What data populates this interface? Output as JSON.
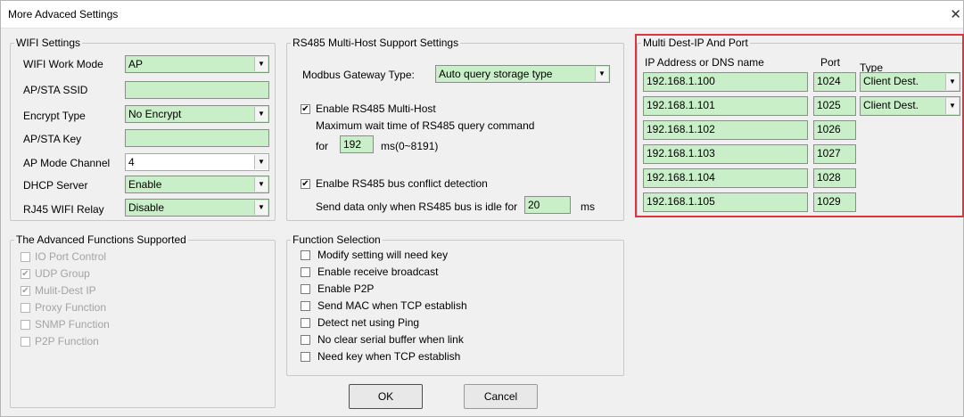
{
  "window": {
    "title": "More Advaced Settings",
    "close_glyph": "✕"
  },
  "wifi": {
    "legend": "WIFI Settings",
    "work_mode_label": "WIFI Work Mode",
    "work_mode_value": "AP",
    "ssid_label": "AP/STA SSID",
    "ssid_value": "",
    "encrypt_label": "Encrypt Type",
    "encrypt_value": "No Encrypt",
    "key_label": "AP/STA Key",
    "key_value": "",
    "channel_label": "AP Mode Channel",
    "channel_value": "4",
    "dhcp_label": "DHCP Server",
    "dhcp_value": "Enable",
    "relay_label": "RJ45 WIFI Relay",
    "relay_value": "Disable"
  },
  "rs485": {
    "legend": "RS485 Multi-Host Support Settings",
    "gateway_label": "Modbus Gateway Type:",
    "gateway_value": "Auto query storage type",
    "multihost_label": "Enable RS485 Multi-Host",
    "multihost_checked": true,
    "wait_text": "Maximum wait time of RS485  query command",
    "for_label": "for",
    "wait_value": "192",
    "wait_unit": "ms(0~8191)",
    "conflict_label": "Enalbe RS485 bus conflict detection",
    "conflict_checked": true,
    "idle_text": "Send data only when RS485 bus is idle for",
    "idle_value": "20",
    "idle_unit": "ms"
  },
  "multi_dest": {
    "legend": "Multi Dest-IP And Port",
    "col_ip": "IP Address or DNS name",
    "col_port": "Port",
    "col_type": "Type",
    "rows": [
      {
        "ip": "192.168.1.100",
        "port": "1024",
        "type": "Client Dest."
      },
      {
        "ip": "192.168.1.101",
        "port": "1025",
        "type": "Client Dest."
      },
      {
        "ip": "192.168.1.102",
        "port": "1026",
        "type": ""
      },
      {
        "ip": "192.168.1.103",
        "port": "1027",
        "type": ""
      },
      {
        "ip": "192.168.1.104",
        "port": "1028",
        "type": ""
      },
      {
        "ip": "192.168.1.105",
        "port": "1029",
        "type": ""
      }
    ]
  },
  "advanced": {
    "legend": "The Advanced Functions Supported",
    "items": [
      {
        "label": "IO Port Control",
        "checked": false
      },
      {
        "label": "UDP Group",
        "checked": true
      },
      {
        "label": "Mulit-Dest IP",
        "checked": true
      },
      {
        "label": "Proxy Function",
        "checked": false
      },
      {
        "label": "SNMP Function",
        "checked": false
      },
      {
        "label": "P2P Function",
        "checked": false
      }
    ]
  },
  "functions": {
    "legend": "Function Selection",
    "items": [
      {
        "label": "Modify setting will need key",
        "checked": false
      },
      {
        "label": "Enable receive broadcast",
        "checked": false
      },
      {
        "label": "Enable P2P",
        "checked": false
      },
      {
        "label": "Send MAC when TCP establish",
        "checked": false
      },
      {
        "label": "Detect net using Ping",
        "checked": false
      },
      {
        "label": "No clear serial buffer when link",
        "checked": false
      },
      {
        "label": "Need key when TCP establish",
        "checked": false
      }
    ]
  },
  "buttons": {
    "ok": "OK",
    "cancel": "Cancel"
  },
  "glyphs": {
    "dropdown_arrow": "▼",
    "check_mark": "✔"
  },
  "colors": {
    "field_green": "#c9efc9",
    "highlight_red": "#d9363e",
    "window_bg": "#f0f0f0"
  }
}
